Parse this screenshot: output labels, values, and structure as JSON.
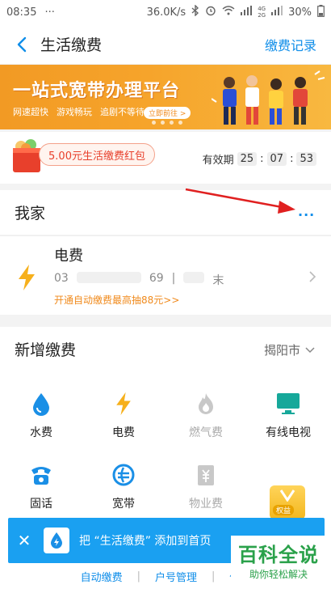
{
  "status_bar": {
    "time": "08:35",
    "more": "···",
    "speed": "36.0K/s",
    "network_4g": "4G",
    "network_2g": "2G",
    "battery": "30%"
  },
  "nav": {
    "title": "生活缴费",
    "right_link": "缴费记录"
  },
  "banner": {
    "headline": "一站式宽带办理平台",
    "tags": [
      "网速超快",
      "游戏畅玩",
      "追剧不等待"
    ],
    "button": "立即前往 >"
  },
  "coupon": {
    "label": "5.00元生活缴费红包",
    "expiry_label": "有效期",
    "hours": "25",
    "minutes": "07",
    "seconds": "53"
  },
  "home": {
    "title": "我家",
    "more": "···"
  },
  "bill": {
    "name": "电费",
    "account_start": "03",
    "account_end": "69",
    "separator": "|",
    "owner_tail": "末",
    "promo": "开通自动缴费最高抽88元>>"
  },
  "new_payment": {
    "title": "新增缴费",
    "city": "揭阳市",
    "items": [
      {
        "label": "水费",
        "icon": "water-drop-icon",
        "disabled": false
      },
      {
        "label": "电费",
        "icon": "lightning-icon",
        "disabled": false
      },
      {
        "label": "燃气费",
        "icon": "flame-icon",
        "disabled": true
      },
      {
        "label": "有线电视",
        "icon": "tv-icon",
        "disabled": false
      },
      {
        "label": "固话",
        "icon": "telephone-icon",
        "disabled": false
      },
      {
        "label": "宽带",
        "icon": "broadband-icon",
        "disabled": false
      },
      {
        "label": "物业费",
        "icon": "building-icon",
        "disabled": true
      }
    ]
  },
  "vip_badge": {
    "tag": "权益"
  },
  "toast": {
    "message": "把 “生活缴费” 添加到首页"
  },
  "bottom_links": {
    "auto_pay": "自动缴费",
    "account_manage": "户号管理",
    "use": "使用"
  },
  "watermark": {
    "big": "百科全说",
    "small": "助你轻松解决"
  },
  "colors": {
    "accent": "#108ee9",
    "orange": "#f08a1c",
    "toast_bg": "#1aa0f1"
  }
}
